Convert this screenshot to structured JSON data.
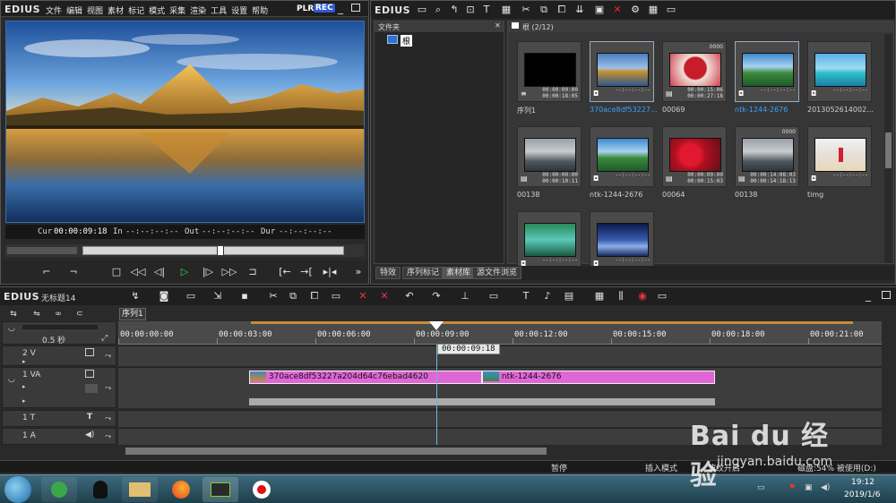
{
  "app": {
    "logo": "EDIUS",
    "menu": [
      "文件",
      "编辑",
      "视图",
      "素材",
      "标记",
      "模式",
      "采集",
      "渲染",
      "工具",
      "设置",
      "帮助"
    ],
    "plr": "PLR",
    "rec": "REC"
  },
  "player": {
    "cur_label": "Cur",
    "cur_value": "00:00:09:18",
    "in_label": "In",
    "in_value": "--:--:--:--",
    "out_label": "Out",
    "out_value": "--:--:--:--",
    "dur_label": "Dur",
    "dur_value": "--:--:--:--"
  },
  "bin": {
    "logo": "EDIUS",
    "folder_header": "文件夹",
    "root_label": "根",
    "clip_header": "根 (2/12)",
    "clips": [
      {
        "label": "序列1",
        "time1": "00:00:00:00",
        "time2": "00:00:18:05",
        "badge": "",
        "selected": false,
        "type": "sequence"
      },
      {
        "label": "370ace8df53227...",
        "time1": "--:--:--:--",
        "time2": "",
        "badge": "",
        "selected": true,
        "type": "still"
      },
      {
        "label": "00069",
        "time1": "00:00:15:06",
        "time2": "00:00:27:18",
        "badge": "0000",
        "selected": false,
        "type": "video"
      },
      {
        "label": "ntk-1244-2676",
        "time1": "--:--:--:--",
        "time2": "",
        "badge": "",
        "selected": true,
        "type": "still"
      },
      {
        "label": "20130526140022...",
        "time1": "--:--:--:--",
        "time2": "",
        "badge": "",
        "selected": false,
        "type": "still"
      },
      {
        "label": "00138",
        "time1": "00:00:00:00",
        "time2": "00:00:10:11",
        "badge": "",
        "selected": false,
        "type": "video"
      },
      {
        "label": "ntk-1244-2676",
        "time1": "--:--:--:--",
        "time2": "",
        "badge": "",
        "selected": false,
        "type": "still"
      },
      {
        "label": "00064",
        "time1": "00:00:00:00",
        "time2": "00:00:15:03",
        "badge": "",
        "selected": false,
        "type": "video"
      },
      {
        "label": "00138",
        "time1": "00:00:14:08:03",
        "time2": "00:00:14:18:13",
        "badge": "0000",
        "selected": false,
        "type": "video"
      },
      {
        "label": "timg",
        "time1": "--:--:--:--",
        "time2": "",
        "badge": "",
        "selected": false,
        "type": "still"
      },
      {
        "label": "",
        "time1": "--:--:--:--",
        "time2": "",
        "badge": "",
        "selected": false,
        "type": "still"
      },
      {
        "label": "",
        "time1": "--:--:--:--",
        "time2": "",
        "badge": "",
        "selected": false,
        "type": "still"
      }
    ],
    "tabs": [
      "特效",
      "序列标记",
      "素材库",
      "源文件浏览"
    ]
  },
  "timeline": {
    "logo": "EDIUS",
    "project": "无标题14",
    "sequence_tab": "序列1",
    "zoom": "0.5 秒",
    "ruler": [
      "00:00:00:00",
      "00:00:03:00",
      "00:00:06:00",
      "00:00:09:00",
      "00:00:12:00",
      "00:00:15:00",
      "00:00:18:00",
      "00:00:21:00"
    ],
    "cursor_tooltip": "00:00:09:18",
    "tracks": [
      {
        "name": "2 V"
      },
      {
        "name": "1 VA"
      },
      {
        "name": "1 T"
      },
      {
        "name": "1 A"
      }
    ],
    "clips": [
      {
        "label": "370ace8df53227a204d64c76ebad4620"
      },
      {
        "label": "ntk-1244-2676"
      }
    ]
  },
  "status": {
    "pause": "暂停",
    "insert_mode": "插入模式",
    "ripple": "波纹开启",
    "disk": "磁盘:54% 被使用(D:)"
  },
  "taskbar": {
    "time": "19:12",
    "date": "2019/1/6"
  },
  "watermark": {
    "brand": "Bai du 经验",
    "url": "jingyan.baidu.com"
  }
}
